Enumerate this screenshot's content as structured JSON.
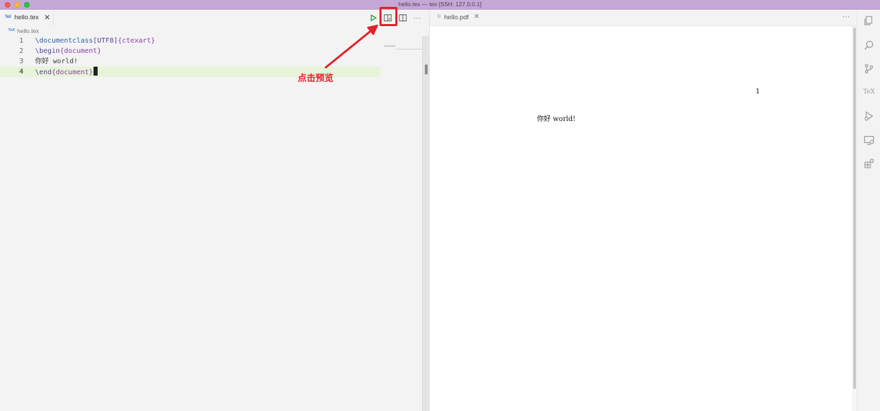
{
  "window": {
    "title": "hello.tex — tex [SSH: 127.0.0.1]"
  },
  "left_editor": {
    "tab": {
      "icon_text": "TeX",
      "label": "hello.tex",
      "close": "✕"
    },
    "actions": {
      "run_icon": "play-icon",
      "preview_icon": "preview-pane-icon",
      "split_icon": "split-editor-icon",
      "more": "···"
    },
    "breadcrumb": {
      "icon_text": "TeX",
      "label": "hello.tex"
    },
    "lines": [
      {
        "number": "1"
      },
      {
        "number": "2"
      },
      {
        "number": "3"
      },
      {
        "number": "4"
      }
    ],
    "code": {
      "l1_cmd": "\\documentclass",
      "l1_opt": "[UTF8]",
      "l1_arg": "{ctexart}",
      "l2_cmd": "\\begin",
      "l2_arg": "{document}",
      "l3_text": "你好 world!",
      "l4_cmd": "\\end",
      "l4_arg": "{document}"
    }
  },
  "annotation": {
    "text": "点击预览",
    "color": "#e4202a"
  },
  "right_editor": {
    "tab": {
      "icon_text": "©",
      "label": "hello.pdf",
      "close": "✕"
    },
    "more": "···",
    "pdf": {
      "page_number": "1",
      "body_text": "你好 world!"
    }
  },
  "activity_bar": {
    "items": [
      "explorer-icon",
      "search-icon",
      "source-control-icon",
      "tex-icon",
      "run-debug-icon",
      "remote-explorer-icon",
      "extensions-icon"
    ],
    "tex_label": "TeX"
  },
  "colors": {
    "title_bar": "#c6a8d6",
    "current_line": "#e6f4d8",
    "accent_red": "#e4202a"
  }
}
